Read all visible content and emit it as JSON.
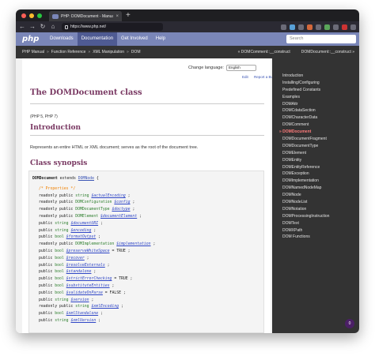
{
  "browser": {
    "tab_title": "PHP: DOMDocument - Manual",
    "tab_close": "×",
    "new_tab": "+",
    "url": "https://www.php.net/"
  },
  "phpnav": {
    "logo": "php",
    "items": [
      "Downloads",
      "Documentation",
      "Get Involved",
      "Help"
    ],
    "active": "Documentation",
    "search_placeholder": "Search"
  },
  "breadcrumb": {
    "items": [
      "PHP Manual",
      "Function Reference",
      "XML Manipulation",
      "DOM"
    ],
    "separator": "»",
    "prev": "« DOMComment::__construct",
    "next": "DOMDocument::__construct »"
  },
  "page": {
    "change_language_label": "Change language:",
    "language_value": "English",
    "edit_link": "Edit",
    "report_bug_link": "Report a Bug",
    "title": "The DOMDocument class",
    "version": "(PHP 5, PHP 7)",
    "intro_heading": "Introduction",
    "intro_text": "Represents an entire HTML or XML document; serves as the root of the document tree.",
    "synopsis_heading": "Class synopsis"
  },
  "synopsis": {
    "class_line": {
      "name": "DOMDocument",
      "extends": "extends",
      "parent": "DOMNode",
      "brace": "{"
    },
    "comment": "/* Properties */",
    "properties": [
      {
        "mods": "readonly public",
        "type": "string",
        "var": "$actualEncoding",
        "tail": ";"
      },
      {
        "mods": "readonly public",
        "type": "DOMConfiguration",
        "var": "$config",
        "tail": ";"
      },
      {
        "mods": "readonly public",
        "type": "DOMDocumentType",
        "var": "$doctype",
        "tail": ";"
      },
      {
        "mods": "readonly public",
        "type": "DOMElement",
        "var": "$documentElement",
        "tail": ";"
      },
      {
        "mods": "public",
        "type": "string",
        "var": "$documentURI",
        "tail": ";"
      },
      {
        "mods": "public",
        "type": "string",
        "var": "$encoding",
        "tail": ";"
      },
      {
        "mods": "public",
        "type": "bool",
        "var": "$formatOutput",
        "tail": ";"
      },
      {
        "mods": "readonly public",
        "type": "DOMImplementation",
        "var": "$implementation",
        "tail": ";"
      },
      {
        "mods": "public",
        "type": "bool",
        "var": "$preserveWhiteSpace",
        "tail": "= TRUE ;"
      },
      {
        "mods": "public",
        "type": "bool",
        "var": "$recover",
        "tail": ";"
      },
      {
        "mods": "public",
        "type": "bool",
        "var": "$resolveExternals",
        "tail": ";"
      },
      {
        "mods": "public",
        "type": "bool",
        "var": "$standalone",
        "tail": ";"
      },
      {
        "mods": "public",
        "type": "bool",
        "var": "$strictErrorChecking",
        "tail": "= TRUE ;"
      },
      {
        "mods": "public",
        "type": "bool",
        "var": "$substituteEntities",
        "tail": ";"
      },
      {
        "mods": "public",
        "type": "bool",
        "var": "$validateOnParse",
        "tail": "= FALSE ;"
      },
      {
        "mods": "public",
        "type": "string",
        "var": "$version",
        "tail": ";"
      },
      {
        "mods": "readonly public",
        "type": "string",
        "var": "$xmlEncoding",
        "tail": ";"
      },
      {
        "mods": "public",
        "type": "bool",
        "var": "$xmlStandalone",
        "tail": ";"
      },
      {
        "mods": "public",
        "type": "string",
        "var": "$xmlVersion",
        "tail": ";"
      }
    ]
  },
  "sidebar": {
    "current": "DOMDocument",
    "items": [
      "Introduction",
      "Installing/Configuring",
      "Predefined Constants",
      "Examples",
      "DOMAttr",
      "DOMCdataSection",
      "DOMCharacterData",
      "DOMComment",
      "DOMDocument",
      "DOMDocumentFragment",
      "DOMDocumentType",
      "DOMElement",
      "DOMEntity",
      "DOMEntityReference",
      "DOMException",
      "DOMImplementation",
      "DOMNamedNodeMap",
      "DOMNode",
      "DOMNodeList",
      "DOMNotation",
      "DOMProcessingInstruction",
      "DOMText",
      "DOMXPath",
      "DOM Functions"
    ]
  },
  "fab_label": "0",
  "colors": {
    "php_nav": "#7a86b8",
    "php_nav_active": "#4f5b93",
    "heading": "#793862",
    "sidebar": "#333333",
    "current_item": "#ff7b7b"
  }
}
